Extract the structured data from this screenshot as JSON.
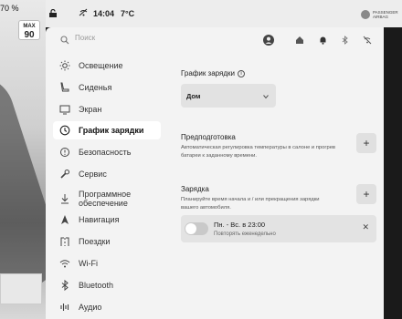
{
  "status": {
    "battery": "70 %",
    "speed_limit_label": "MAX",
    "speed_limit_value": "90",
    "time": "14:04",
    "temperature": "7°C",
    "airbag_label_line1": "PASSENGER",
    "airbag_label_line2": "AIRBAG"
  },
  "search": {
    "placeholder": "Поиск"
  },
  "menu": {
    "items": [
      {
        "label": "Освещение",
        "icon": "sun-icon"
      },
      {
        "label": "Сиденья",
        "icon": "seat-icon"
      },
      {
        "label": "Экран",
        "icon": "screen-icon"
      },
      {
        "label": "График зарядки",
        "icon": "clock-icon",
        "active": true
      },
      {
        "label": "Безопасность",
        "icon": "shield-icon"
      },
      {
        "label": "Сервис",
        "icon": "wrench-icon"
      },
      {
        "label": "Программное обеспечение",
        "icon": "download-icon"
      },
      {
        "label": "Навигация",
        "icon": "navigation-icon"
      },
      {
        "label": "Поездки",
        "icon": "trips-icon"
      },
      {
        "label": "Wi-Fi",
        "icon": "wifi-icon"
      },
      {
        "label": "Bluetooth",
        "icon": "bluetooth-icon"
      },
      {
        "label": "Аудио",
        "icon": "audio-icon"
      }
    ]
  },
  "charging": {
    "title": "График зарядки",
    "location_value": "Дом",
    "precondition_title": "Предподготовка",
    "precondition_desc": "Автоматическая регулировка температуры в салоне и прогрев батареи к заданному времени.",
    "charge_title": "Зарядка",
    "charge_desc": "Планируйте время начала и / или прекращения зарядки вашего автомобиля.",
    "schedule_time": "Пн. - Вс. в 23:00",
    "schedule_repeat": "Повторять еженедельно"
  }
}
